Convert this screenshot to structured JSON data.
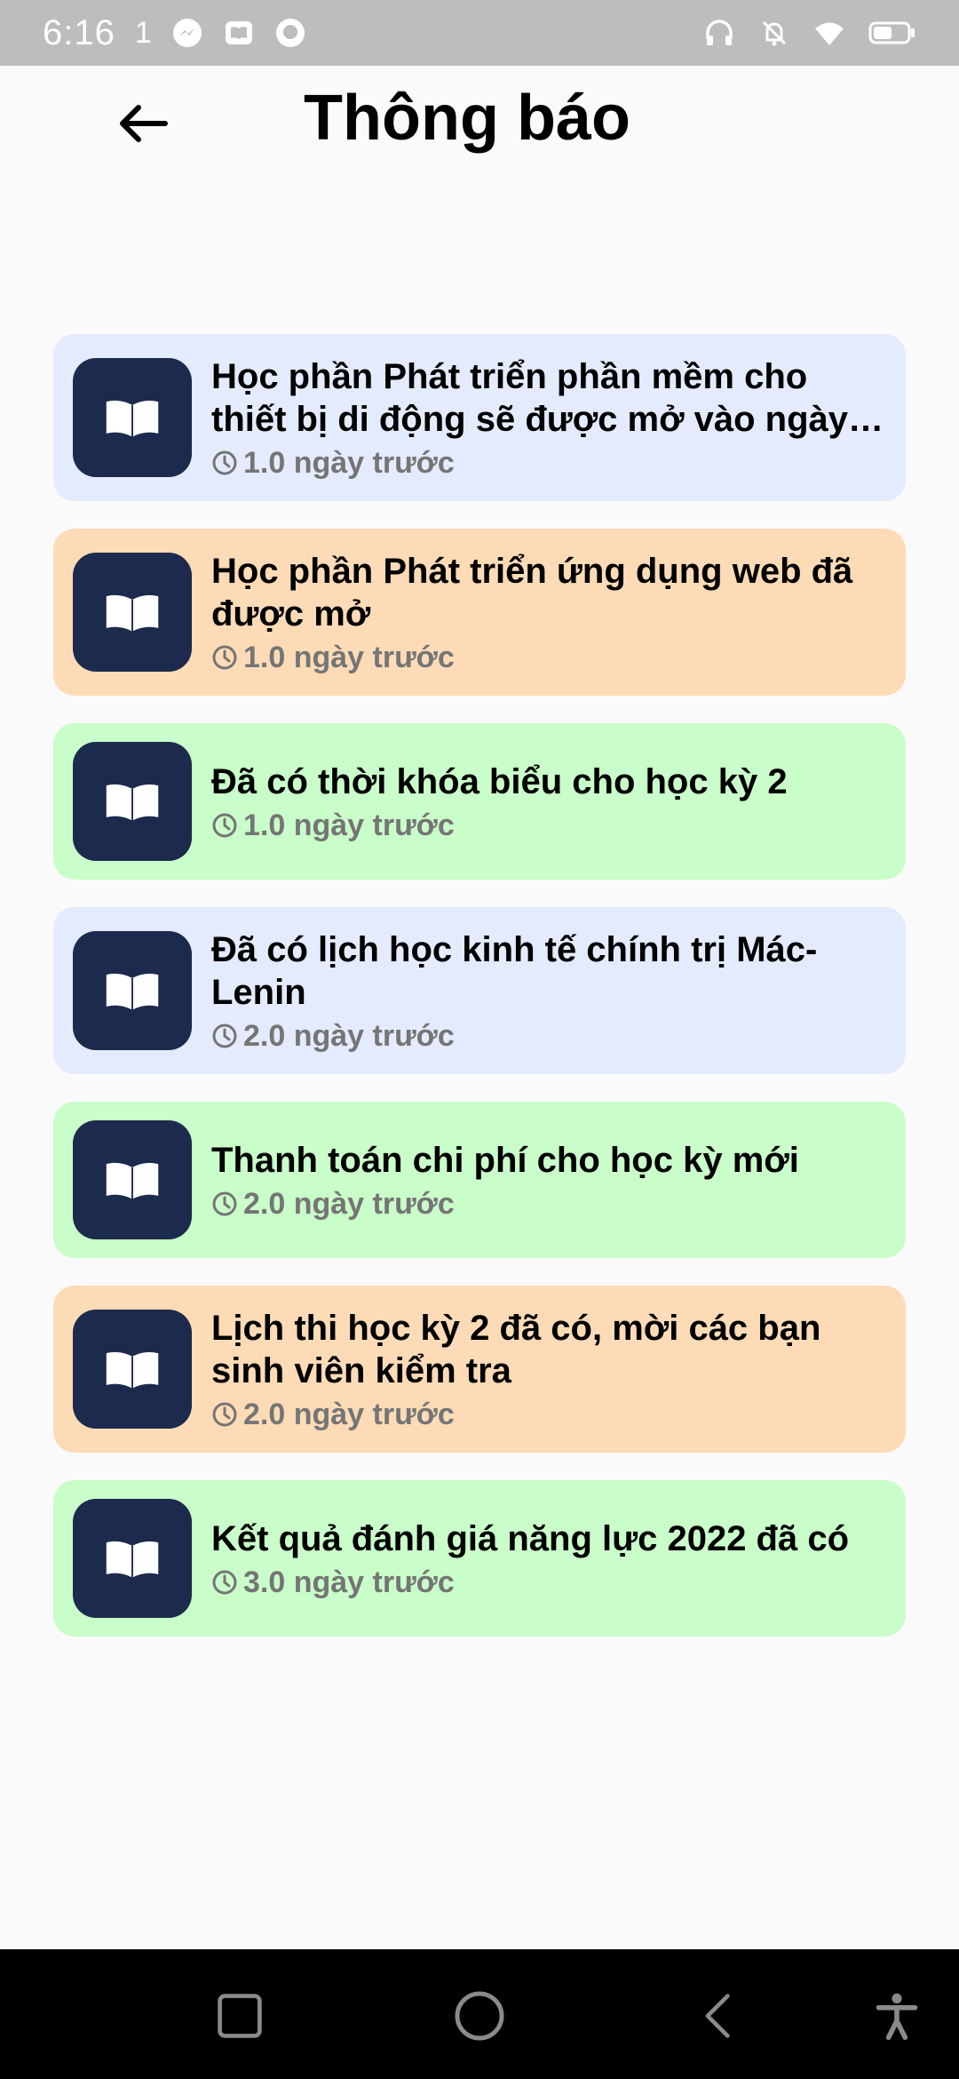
{
  "status_bar": {
    "time": "6:16",
    "indicator": "1",
    "icons": [
      "messenger-icon",
      "book-app-icon",
      "chat-app-icon",
      "headphones-icon",
      "bell-off-icon",
      "wifi-icon",
      "battery-icon"
    ]
  },
  "header": {
    "title": "Thông báo",
    "back_icon": "arrow-left-icon"
  },
  "notifications": [
    {
      "title": "Học phần Phát triển phần mềm cho thiết bị di động sẽ được mở vào ngày ...",
      "time": "1.0 ngày trước",
      "color": "#e3ebfd"
    },
    {
      "title": "Học phần Phát triển ứng dụng web đã được mở",
      "time": "1.0 ngày trước",
      "color": "#fddbb6"
    },
    {
      "title": "Đã có thời khóa biểu cho học kỳ 2",
      "time": "1.0 ngày trước",
      "color": "#c9fdc9"
    },
    {
      "title": "Đã có lịch học kinh tế chính trị Mác-Lenin",
      "time": "2.0 ngày trước",
      "color": "#e3ebfd"
    },
    {
      "title": "Thanh toán chi phí cho học kỳ mới",
      "time": "2.0 ngày trước",
      "color": "#c9fdc9"
    },
    {
      "title": "Lịch thi học kỳ 2 đã có, mời các bạn sinh viên kiểm tra",
      "time": "2.0 ngày trước",
      "color": "#fddbb6"
    },
    {
      "title": "Kết quả đánh giá năng lực 2022 đã có",
      "time": "3.0 ngày trước",
      "color": "#c9fdc9"
    }
  ],
  "colors": {
    "icon_bg": "#1c2b4d",
    "time_text": "#757575",
    "status_bar_bg": "#bdbdbd",
    "nav_bar_bg": "#000000"
  },
  "nav_bar": {
    "icons": [
      "recents-square-icon",
      "home-circle-icon",
      "back-triangle-icon",
      "accessibility-icon"
    ]
  }
}
